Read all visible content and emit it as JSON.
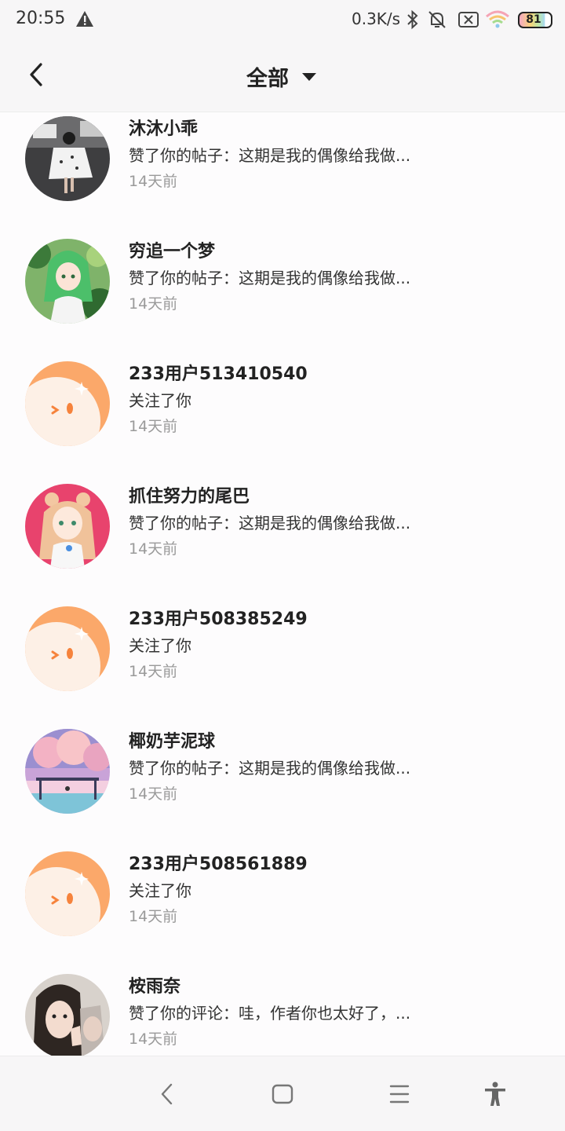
{
  "status_bar": {
    "time": "20:55",
    "net_speed": "0.3K/s",
    "battery": "81",
    "icons": [
      "warning-icon",
      "bluetooth-icon",
      "bell-muted-icon",
      "sim-off-icon",
      "wifi-icon",
      "battery-icon"
    ]
  },
  "header": {
    "title": "全部",
    "back_icon": "chevron-left-icon",
    "dropdown_icon": "caret-down-icon"
  },
  "notifications": [
    {
      "name": "沐沐小乖",
      "message": "赞了你的帖子：这期是我的偶像给我做...",
      "time": "14天前",
      "avatar": "photo-girl-street"
    },
    {
      "name": "穷追一个梦",
      "message": "赞了你的帖子：这期是我的偶像给我做...",
      "time": "14天前",
      "avatar": "anime-green-hair"
    },
    {
      "name": "233用户513410540",
      "message": "关注了你",
      "time": "14天前",
      "avatar": "default-orange"
    },
    {
      "name": "抓住努力的尾巴",
      "message": "赞了你的帖子：这期是我的偶像给我做...",
      "time": "14天前",
      "avatar": "anime-pink-bg"
    },
    {
      "name": "233用户508385249",
      "message": "关注了你",
      "time": "14天前",
      "avatar": "default-orange"
    },
    {
      "name": "椰奶芋泥球",
      "message": "赞了你的帖子：这期是我的偶像给我做...",
      "time": "14天前",
      "avatar": "pink-sky-scenery"
    },
    {
      "name": "233用户508561889",
      "message": "关注了你",
      "time": "14天前",
      "avatar": "default-orange"
    },
    {
      "name": "桉雨奈",
      "message": "赞了你的评论：哇，作者你也太好了，...",
      "time": "14天前",
      "avatar": "photo-girl-selfie"
    }
  ],
  "nav_bar": {
    "icons": [
      "back-nav-icon",
      "home-nav-icon",
      "menu-nav-icon",
      "accessibility-icon"
    ]
  }
}
